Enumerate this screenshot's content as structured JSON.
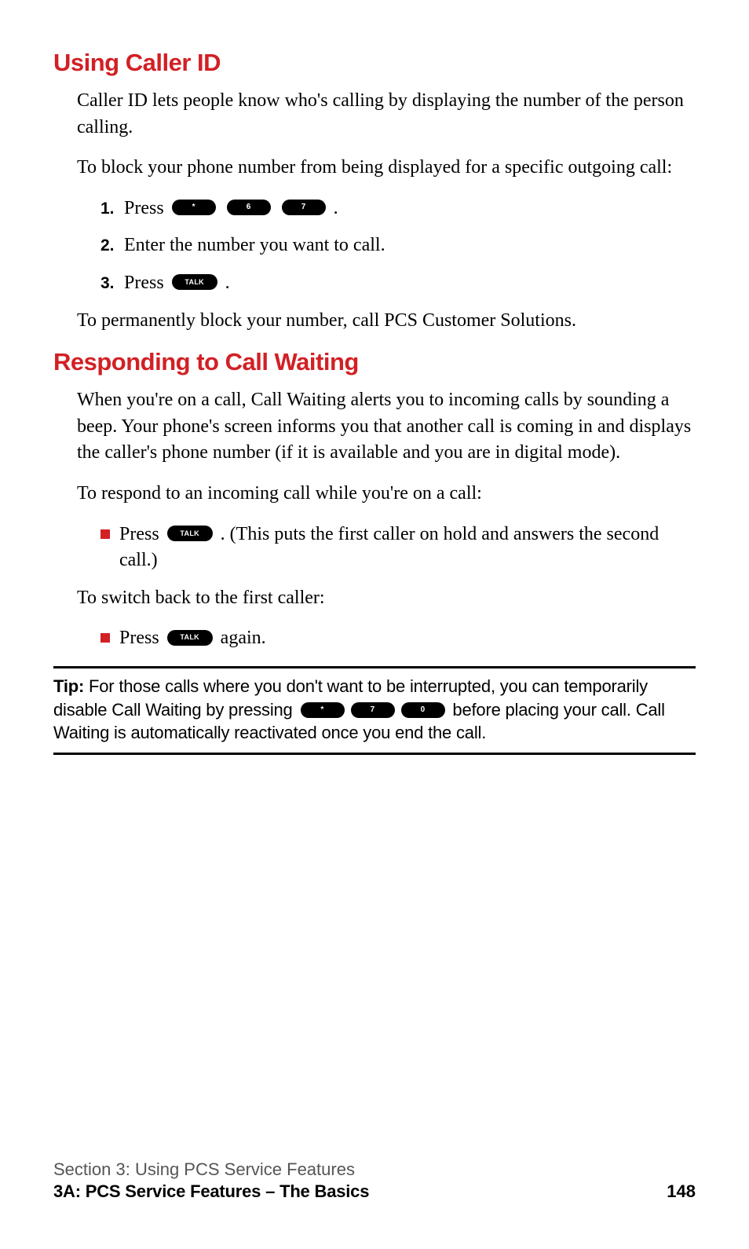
{
  "section1": {
    "heading": "Using Caller ID",
    "p1": "Caller ID lets people know who's calling by displaying the number of the person calling.",
    "p2": "To block your phone number from being displayed for a specific outgoing call:",
    "steps": {
      "s1_num": "1.",
      "s1_a": "Press",
      "s1_key1": "*",
      "s1_key2": "6",
      "s1_key3": "7",
      "s1_b": ".",
      "s2_num": "2.",
      "s2_a": "Enter the number you want to call.",
      "s3_num": "3.",
      "s3_a": "Press",
      "s3_key1": "TALK",
      "s3_b": "."
    },
    "p3": "To permanently block your number, call PCS Customer Solutions."
  },
  "section2": {
    "heading": "Responding to Call Waiting",
    "p1": "When you're on a call, Call Waiting alerts you to incoming calls by sounding a beep. Your phone's screen informs you that another call is coming in and displays the caller's phone number (if it is available and you are in digital mode).",
    "p2": "To respond to an incoming call while you're on a call:",
    "b1_a": "Press",
    "b1_key1": "TALK",
    "b1_b": ". (This puts the first caller on hold and answers the second call.)",
    "p3": "To switch back to the first caller:",
    "b2_a": "Press",
    "b2_key1": "TALK",
    "b2_b": " again."
  },
  "tip": {
    "label": "Tip:",
    "a": " For those calls where you don't want to be interrupted, you can temporarily disable Call Waiting by pressing ",
    "key1": "*",
    "key2": "7",
    "key3": "0",
    "b": " before placing your call. Call Waiting is automatically reactivated once you end the call."
  },
  "footer": {
    "top": "Section 3: Using PCS Service Features",
    "bottom": "3A: PCS Service Features – The Basics",
    "page": "148"
  }
}
